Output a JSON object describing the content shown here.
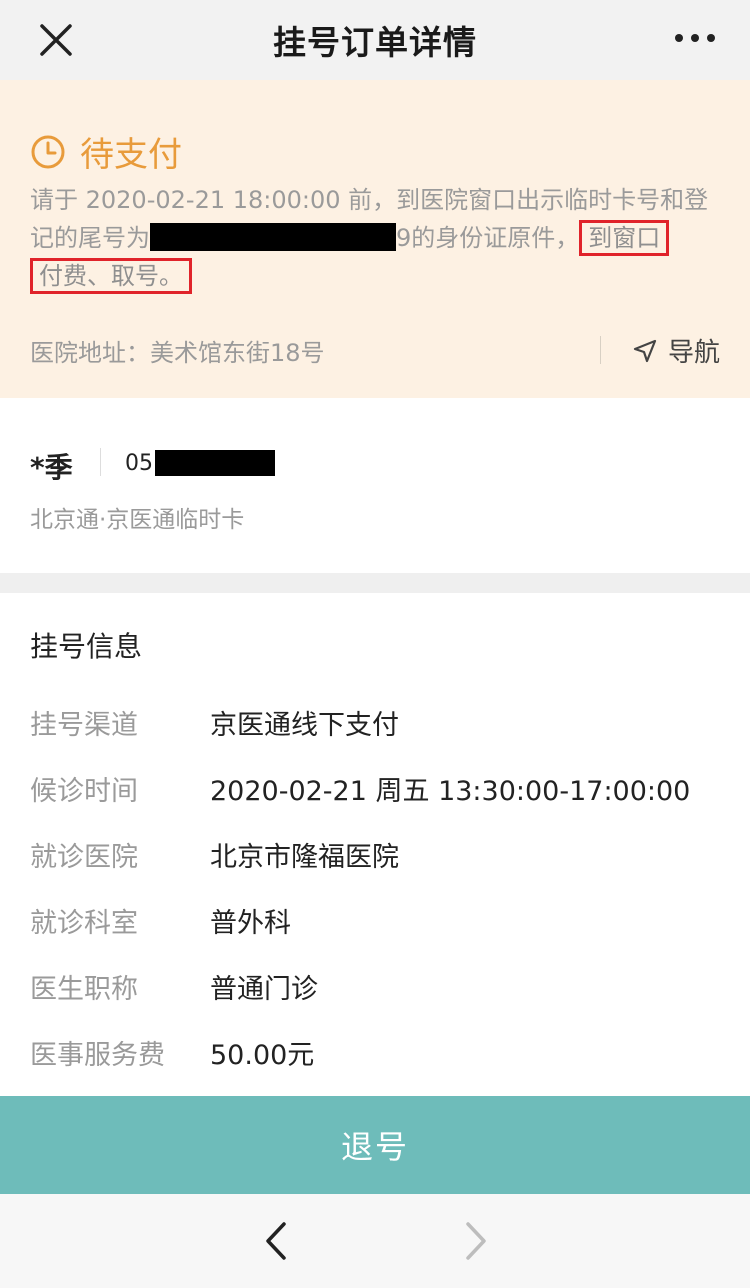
{
  "header": {
    "title": "挂号订单详情",
    "close_icon": "close-icon",
    "more_icon": "more-icon"
  },
  "status": {
    "label": "待支付",
    "icon": "clock-icon",
    "color": "#e89b3b",
    "notice_part1": "请于 2020-02-21 18:00:00 前，到医院窗口出示临时卡号和登记的尾号为",
    "notice_part2": "9的身份证原件，",
    "notice_highlight_1": "到窗口",
    "notice_highlight_2": "付费、取号。",
    "address_label": "医院地址：",
    "address": "美术馆东街18号",
    "navigate_label": "导航"
  },
  "patient": {
    "name": "*季",
    "card_prefix": "05",
    "card_type": "北京通·京医通临时卡"
  },
  "registration": {
    "section_title": "挂号信息",
    "rows": [
      {
        "label": "挂号渠道",
        "value": "京医通线下支付"
      },
      {
        "label": "候诊时间",
        "value": "2020-02-21 周五 13:30:00-17:00:00"
      },
      {
        "label": "就诊医院",
        "value": "北京市隆福医院"
      },
      {
        "label": "就诊科室",
        "value": "普外科"
      },
      {
        "label": "医生职称",
        "value": "普通门诊"
      },
      {
        "label": "医事服务费",
        "value": "50.00元"
      }
    ]
  },
  "actions": {
    "refund_label": "退号",
    "refund_color": "#6ebcba"
  },
  "browser_nav": {
    "back_icon": "chevron-left-icon",
    "forward_icon": "chevron-right-icon"
  }
}
